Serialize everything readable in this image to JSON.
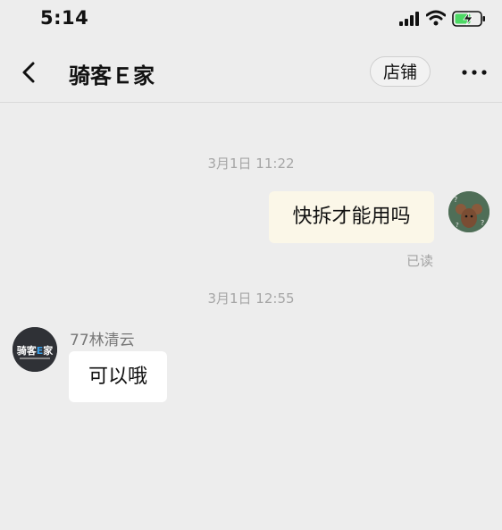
{
  "status_bar": {
    "time": "5:14",
    "icons": [
      "signal-icon",
      "wifi-icon",
      "battery-charging-icon"
    ],
    "battery_color": "#4cd964"
  },
  "nav": {
    "back_icon": "chevron-left-icon",
    "title": "骑客Ｅ家",
    "shop_label": "店铺",
    "more_icon": "more-dots-icon"
  },
  "messages": [
    {
      "timestamp": "3月1日 11:22",
      "side": "right",
      "text": "快拆才能用吗",
      "status": "已读",
      "avatar_icon": "mouse-avatar",
      "bubble_color": "#fbf7e8"
    },
    {
      "timestamp": "3月1日 12:55",
      "side": "left",
      "sender": "77林清云",
      "text": "可以哦",
      "avatar_icon": "shop-logo-avatar",
      "avatar_text": "骑客E家",
      "bubble_color": "#ffffff"
    }
  ],
  "colors": {
    "background": "#ededed",
    "accent_logo_blue": "#3aa0e8"
  }
}
